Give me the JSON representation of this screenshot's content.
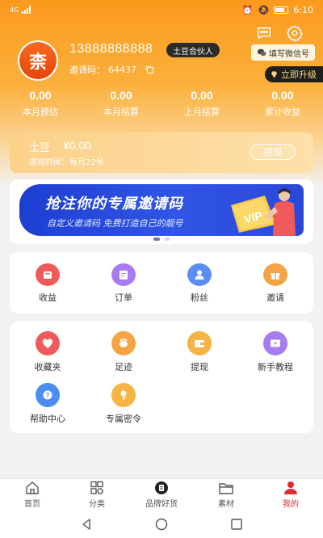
{
  "status_bar": {
    "network": "4G",
    "battery": "",
    "time": "6:10"
  },
  "profile": {
    "avatar_text": "柰",
    "phone": "13888888888",
    "role": "土豆合伙人",
    "invite_label": "邀请码：",
    "invite_code": "64437",
    "wechat_button": "填写微信号",
    "upgrade_button": "立即升级"
  },
  "stats": [
    {
      "value": "0.00",
      "label": "本月预估"
    },
    {
      "value": "0.00",
      "label": "本月结算"
    },
    {
      "value": "0.00",
      "label": "上月结算"
    },
    {
      "value": "0.00",
      "label": "累计收益"
    }
  ],
  "wallet": {
    "title": "土豆",
    "amount": "¥0.00",
    "subtitle": "提现时间：每月22号",
    "withdraw_button": "提现"
  },
  "banner": {
    "title": "抢注你的专属邀请码",
    "subtitle": "自定义邀请码 免费打造自己的靓号",
    "vip_text": "VIP"
  },
  "menu_top": [
    {
      "label": "收益",
      "icon": "income-icon",
      "color": "#f05a5a"
    },
    {
      "label": "订单",
      "icon": "order-icon",
      "color": "#a77cf0"
    },
    {
      "label": "粉丝",
      "icon": "fans-icon",
      "color": "#5b8ef5"
    },
    {
      "label": "邀请",
      "icon": "gift-icon",
      "color": "#f5a444"
    }
  ],
  "menu_bottom": [
    {
      "label": "收藏夹",
      "icon": "heart-icon",
      "color": "#f05a5a"
    },
    {
      "label": "足迹",
      "icon": "footprint-icon",
      "color": "#f5a444"
    },
    {
      "label": "提现",
      "icon": "wallet-icon",
      "color": "#f5b444"
    },
    {
      "label": "新手教程",
      "icon": "video-icon",
      "color": "#a77cf0"
    },
    {
      "label": "帮助中心",
      "icon": "help-icon",
      "color": "#4c8ef0"
    },
    {
      "label": "专属密令",
      "icon": "key-icon",
      "color": "#f5b444"
    }
  ],
  "bottom_nav": [
    {
      "label": "首页",
      "icon": "home-icon"
    },
    {
      "label": "分类",
      "icon": "category-icon"
    },
    {
      "label": "品牌好货",
      "icon": "brand-icon"
    },
    {
      "label": "素材",
      "icon": "folder-icon"
    },
    {
      "label": "我的",
      "icon": "user-icon",
      "active": true
    }
  ]
}
